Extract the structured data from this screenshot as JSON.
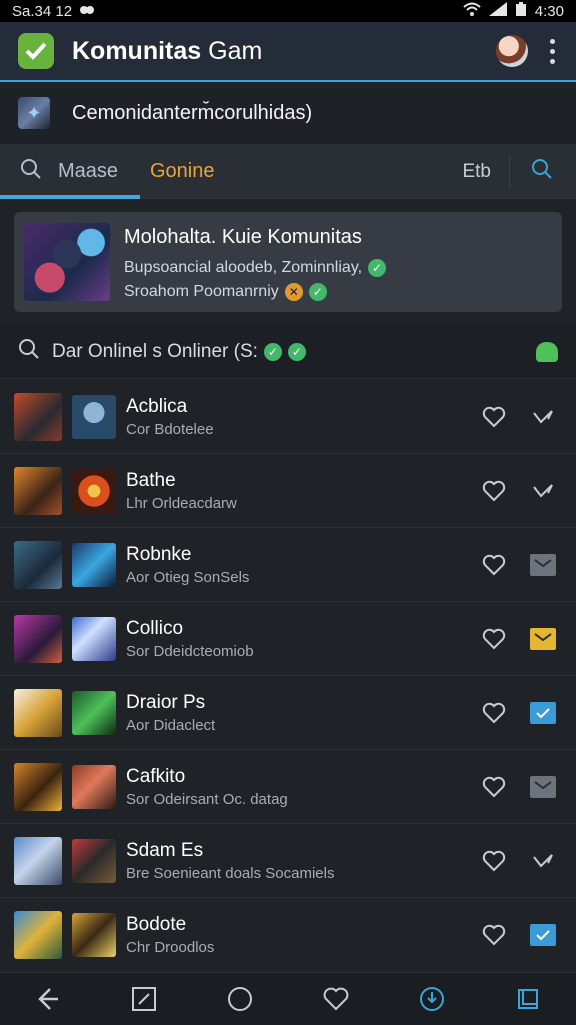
{
  "status_bar": {
    "time": "Sa.34 12",
    "battery": "4:30"
  },
  "app_bar": {
    "title_bold": "Komunitas",
    "title_thin": "Gam"
  },
  "subheader": {
    "title": "Cemonidanterm̆corulhidas)"
  },
  "tabs": {
    "search_label": "Maase",
    "active_label": "Gonine",
    "right_label": "Etb"
  },
  "featured": {
    "title": "Molohalta. Kuie Komunitas",
    "line1": "Bupsoancial aloodeb, Zominnliay,",
    "line2": "Sroahom Poomanrniy"
  },
  "online_header": {
    "label": "Dar Onlinel s Onliner (S:"
  },
  "items": [
    {
      "name": "Acblica",
      "sub": "Cor Bdotelee",
      "trail": "check-plain"
    },
    {
      "name": "Bathe",
      "sub": "Lhr Orldeacdarw",
      "trail": "check-plain"
    },
    {
      "name": "Robnke",
      "sub": "Aor Otieg SonSels",
      "trail": "mail-gray"
    },
    {
      "name": "Collico",
      "sub": "Sor Ddeidcteomiob",
      "trail": "mail-yellow"
    },
    {
      "name": "Draior Ps",
      "sub": "Aor Didaclect",
      "trail": "check-blue"
    },
    {
      "name": "Cafkito",
      "sub": "Sor Odeirsant Oc. datag",
      "trail": "mail-gray"
    },
    {
      "name": "Sdam Es",
      "sub": "Bre Soenieant doals Socamiels",
      "trail": "check-plain"
    },
    {
      "name": "Bodote",
      "sub": "Chr Droodlos",
      "trail": "check-blue"
    }
  ],
  "colors": {
    "accent": "#3aa6d6",
    "online": "#e8a533",
    "background": "#1f2227"
  }
}
